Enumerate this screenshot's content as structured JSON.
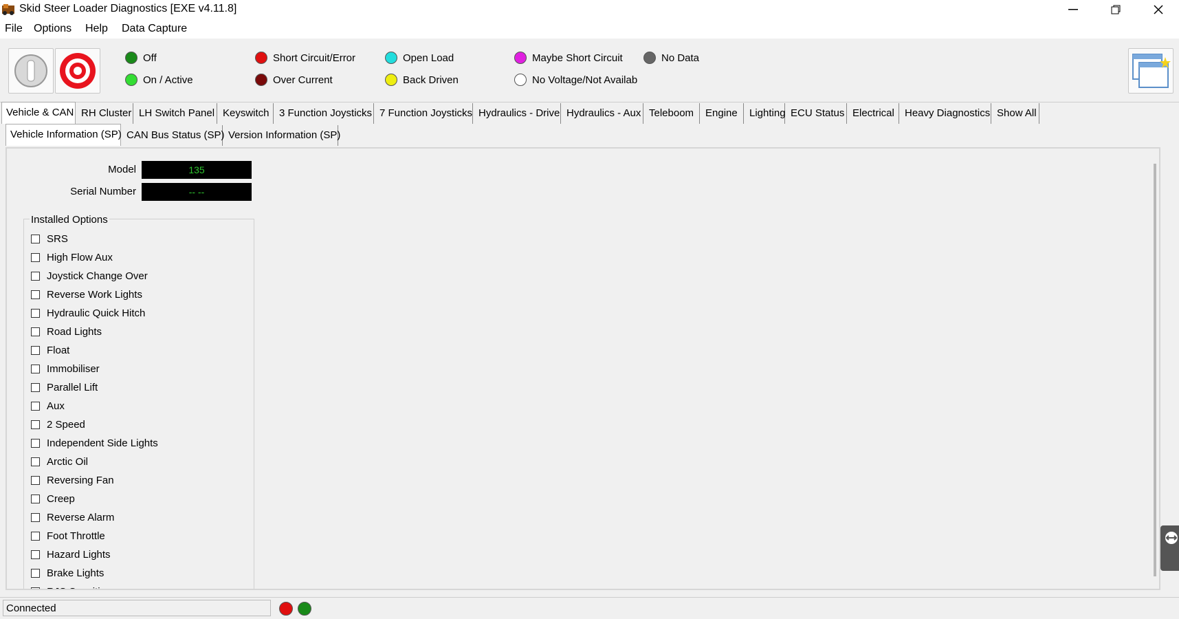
{
  "window": {
    "title": "Skid Steer Loader Diagnostics [EXE v4.11.8]"
  },
  "menu": [
    "File",
    "Options",
    "Help",
    "Data Capture"
  ],
  "legend": [
    {
      "label": "Off",
      "color": "#1a8a1a"
    },
    {
      "label": "On / Active",
      "color": "#33dd33"
    },
    {
      "label": "Short Circuit/Error",
      "color": "#e01010"
    },
    {
      "label": "Over Current",
      "color": "#7a0a0a"
    },
    {
      "label": "Open Load",
      "color": "#22dddd"
    },
    {
      "label": "Back Driven",
      "color": "#eeee11"
    },
    {
      "label": "Maybe Short Circuit",
      "color": "#e020e0"
    },
    {
      "label": "No Voltage/Not Availab",
      "color": "#ffffff"
    },
    {
      "label": "No Data",
      "color": "#666666"
    }
  ],
  "tabs": [
    "Vehicle & CAN",
    "RH Cluster",
    "LH Switch Panel",
    "Keyswitch",
    "3 Function Joysticks",
    "7 Function Joysticks",
    "Hydraulics - Drive",
    "Hydraulics - Aux",
    "Teleboom",
    "Engine",
    "Lighting",
    "ECU Status",
    "Electrical",
    "Heavy Diagnostics",
    "Show All"
  ],
  "subtabs": [
    "Vehicle Information (SP)",
    "CAN Bus Status (SP)",
    "Version Information (SP)"
  ],
  "vehicle": {
    "model_label": "Model",
    "model_value": "135",
    "serial_label": "Serial Number",
    "serial_value": "-- --"
  },
  "installed_options": {
    "title": "Installed Options",
    "items": [
      "SRS",
      "High Flow Aux",
      "Joystick Change Over",
      "Reverse Work Lights",
      "Hydraulic Quick Hitch",
      "Road Lights",
      "Float",
      "Immobiliser",
      "Parallel Lift",
      "Aux",
      "2 Speed",
      "Independent Side Lights",
      "Arctic Oil",
      "Reversing Fan",
      "Creep",
      "Reverse Alarm",
      "Foot Throttle",
      "Hazard Lights",
      "Brake Lights",
      "RJS Sensitive"
    ]
  },
  "status": {
    "text": "Connected",
    "led1_color": "#e01010",
    "led2_color": "#1a8a1a"
  }
}
